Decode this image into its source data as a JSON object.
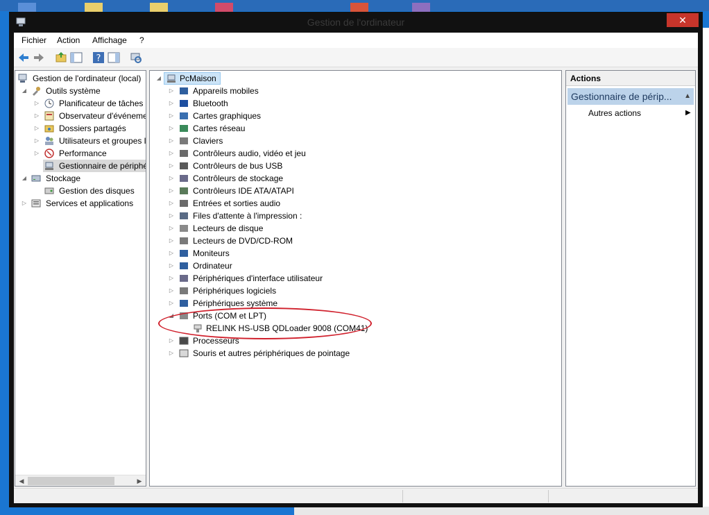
{
  "window": {
    "title": "Gestion de l'ordinateur",
    "close_glyph": "✕"
  },
  "menu": {
    "items": [
      "Fichier",
      "Action",
      "Affichage",
      "?"
    ]
  },
  "toolbar": {
    "icons": [
      "back-arrow-icon",
      "forward-arrow-icon",
      "up-folder-icon",
      "show-hide-console-tree-icon",
      "help-icon",
      "show-hide-action-pane-icon",
      "scan-hardware-icon"
    ]
  },
  "left_tree": {
    "root": "Gestion de l'ordinateur (local)",
    "system_tools": "Outils système",
    "task_scheduler": "Planificateur de tâches",
    "event_viewer": "Observateur d'événeme",
    "shared_folders": "Dossiers partagés",
    "local_users": "Utilisateurs et groupes l",
    "performance": "Performance",
    "device_manager": "Gestionnaire de périphé",
    "storage": "Stockage",
    "disk_management": "Gestion des disques",
    "services": "Services et applications"
  },
  "device_tree": {
    "root": "PcMaison",
    "categories": [
      "Appareils mobiles",
      "Bluetooth",
      "Cartes graphiques",
      "Cartes réseau",
      "Claviers",
      "Contrôleurs audio, vidéo et jeu",
      "Contrôleurs de bus USB",
      "Contrôleurs de stockage",
      "Contrôleurs IDE ATA/ATAPI",
      "Entrées et sorties audio",
      "Files d'attente à l'impression :",
      "Lecteurs de disque",
      "Lecteurs de DVD/CD-ROM",
      "Moniteurs",
      "Ordinateur",
      "Périphériques d'interface utilisateur",
      "Périphériques logiciels",
      "Périphériques système",
      "Ports (COM et LPT)"
    ],
    "ports_child": "RELINK HS-USB QDLoader 9008 (COM41)",
    "after_ports": [
      "Processeurs",
      "Souris et autres périphériques de pointage"
    ]
  },
  "actions": {
    "header": "Actions",
    "section": "Gestionnaire de périp...",
    "item": "Autres actions"
  },
  "colors": {
    "close_red": "#c7352b",
    "section_blue": "#bcd3ea",
    "annotation_red": "#d0202c",
    "desktop_blue": "#1a76d2"
  }
}
